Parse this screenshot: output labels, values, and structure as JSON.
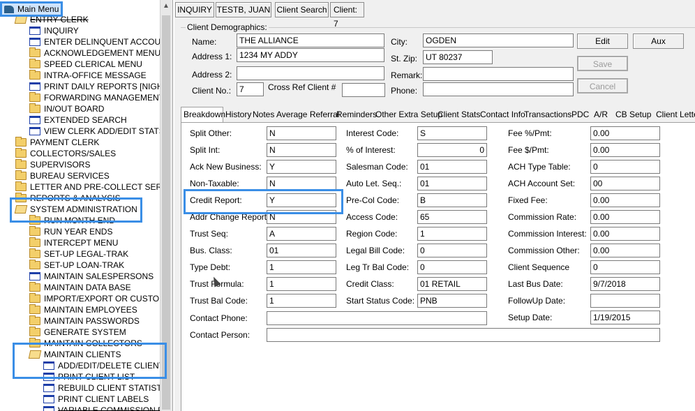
{
  "tree": {
    "main_menu": "Main Menu",
    "items": [
      {
        "label": "ENTRY CLERK",
        "icon": "open-folder-icon",
        "strike": true
      },
      {
        "label": "INQUIRY",
        "icon": "page-icon",
        "strike": false
      },
      {
        "label": "ENTER DELINQUENT ACCOUNT",
        "icon": "page-icon",
        "strike": false
      },
      {
        "label": "ACKNOWLEDGEMENT MENU",
        "icon": "folder-icon",
        "strike": false
      },
      {
        "label": "SPEED CLERICAL MENU",
        "icon": "folder-icon",
        "strike": false
      },
      {
        "label": "INTRA-OFFICE MESSAGE",
        "icon": "folder-icon",
        "strike": false
      },
      {
        "label": "PRINT DAILY REPORTS   [NIGHT",
        "icon": "page-icon",
        "strike": false
      },
      {
        "label": "FORWARDING MANAGEMENT",
        "icon": "folder-icon",
        "strike": false
      },
      {
        "label": "IN/OUT BOARD",
        "icon": "folder-icon",
        "strike": false
      },
      {
        "label": "EXTENDED SEARCH",
        "icon": "page-icon",
        "strike": false
      },
      {
        "label": "VIEW CLERK ADD/EDIT STATS",
        "icon": "page-icon",
        "strike": false
      },
      {
        "label": "PAYMENT CLERK",
        "icon": "folder-icon",
        "strike": false
      },
      {
        "label": "COLLECTORS/SALES",
        "icon": "folder-icon",
        "strike": false
      },
      {
        "label": "SUPERVISORS",
        "icon": "folder-icon",
        "strike": false
      },
      {
        "label": "BUREAU SERVICES",
        "icon": "folder-icon",
        "strike": false
      },
      {
        "label": "LETTER AND PRE-COLLECT SERVIC",
        "icon": "folder-icon",
        "strike": false
      },
      {
        "label": "REPORTS & ANALYSIS",
        "icon": "folder-icon",
        "strike": true
      },
      {
        "label": "SYSTEM ADMINISTRATION",
        "icon": "open-folder-icon",
        "strike": false
      },
      {
        "label": "RUN MONTH END",
        "icon": "folder-icon",
        "strike": true
      },
      {
        "label": "RUN YEAR ENDS",
        "icon": "folder-icon",
        "strike": false
      },
      {
        "label": "INTERCEPT MENU",
        "icon": "folder-icon",
        "strike": false
      },
      {
        "label": "SET-UP LEGAL-TRAK",
        "icon": "folder-icon",
        "strike": false
      },
      {
        "label": "SET-UP LOAN-TRAK",
        "icon": "folder-icon",
        "strike": false
      },
      {
        "label": "MAINTAIN SALESPERSONS",
        "icon": "page-icon",
        "strike": false
      },
      {
        "label": "MAINTAIN DATA BASE",
        "icon": "folder-icon",
        "strike": false
      },
      {
        "label": "IMPORT/EXPORT OR CUSTOM",
        "icon": "folder-icon",
        "strike": false
      },
      {
        "label": "MAINTAIN EMPLOYEES",
        "icon": "folder-icon",
        "strike": false
      },
      {
        "label": "MAINTAIN PASSWORDS",
        "icon": "folder-icon",
        "strike": false
      },
      {
        "label": "GENERATE SYSTEM",
        "icon": "folder-icon",
        "strike": false
      },
      {
        "label": "MAINTAIN COLLECTORS",
        "icon": "folder-icon",
        "strike": true
      },
      {
        "label": "MAINTAIN CLIENTS",
        "icon": "open-folder-icon",
        "strike": false
      },
      {
        "label": "ADD/EDIT/DELETE CLIENTS",
        "icon": "page-icon",
        "strike": false
      },
      {
        "label": "PRINT CLIENT LIST",
        "icon": "page-icon",
        "strike": true
      },
      {
        "label": "REBUILD CLIENT STATISTIC",
        "icon": "page-icon",
        "strike": false
      },
      {
        "label": "PRINT CLIENT LABELS",
        "icon": "page-icon",
        "strike": false
      },
      {
        "label": "VARIABLE COMMISSION RAT",
        "icon": "page-icon",
        "strike": true
      }
    ]
  },
  "toolbar": {
    "inquiry": "INQUIRY",
    "user": "TESTB, JUAN",
    "client_search": "Client Search",
    "client_no": "Client: 7"
  },
  "demographics": {
    "group_label": "Client Demographics:",
    "name_label": "Name:",
    "name": "THE ALLIANCE",
    "address1_label": "Address 1:",
    "address1": "1234 MY ADDY",
    "address2_label": "Address 2:",
    "address2": "",
    "clientno_label": "Client No.:",
    "clientno": "7",
    "crossref_label": "Cross Ref Client #",
    "crossref": "",
    "city_label": "City:",
    "city": "OGDEN",
    "stzip_label": "St. Zip:",
    "stzip": "UT 80237",
    "remark_label": "Remark:",
    "remark": "",
    "phone_label": "Phone:",
    "phone": "",
    "edit": "Edit",
    "aux": "Aux",
    "save": "Save",
    "cancel": "Cancel"
  },
  "tabs": [
    "Breakdown",
    "History",
    "Notes",
    "Average Referral",
    "Reminders",
    "Other Extra Setup",
    "Client Stats",
    "Contact Info",
    "Transactions",
    "PDC",
    "A/R",
    "CB Setup",
    "Client Letter"
  ],
  "breakdown": {
    "col1": [
      {
        "label": "Split Other:",
        "value": "N"
      },
      {
        "label": "Split Int:",
        "value": "N"
      },
      {
        "label": "Ack New Business:",
        "value": "Y"
      },
      {
        "label": "Non-Taxable:",
        "value": "N"
      },
      {
        "label": "Credit Report:",
        "value": "Y"
      },
      {
        "label": "Addr Change Report:",
        "value": "N"
      },
      {
        "label": "Trust Seq:",
        "value": "A"
      },
      {
        "label": "Bus. Class:",
        "value": "01"
      },
      {
        "label": "Type Debt:",
        "value": "1"
      },
      {
        "label": "Trust Formula:",
        "value": "1"
      },
      {
        "label": "Trust Bal Code:",
        "value": "1"
      }
    ],
    "col2": [
      {
        "label": "Interest Code:",
        "value": "S"
      },
      {
        "label": "% of Interest:",
        "value": "0"
      },
      {
        "label": "Salesman Code:",
        "value": "01"
      },
      {
        "label": "Auto Let. Seq.:",
        "value": "01"
      },
      {
        "label": "Pre-Col Code:",
        "value": "B"
      },
      {
        "label": "Access Code:",
        "value": "65"
      },
      {
        "label": "Region Code:",
        "value": "1"
      },
      {
        "label": "Legal Bill Code:",
        "value": "0"
      },
      {
        "label": "Leg Tr Bal Code:",
        "value": "0"
      },
      {
        "label": "Credit Class:",
        "value": "01 RETAIL"
      },
      {
        "label": "Start Status Code:",
        "value": "PNB"
      }
    ],
    "col3": [
      {
        "label": "Fee %/Pmt:",
        "value": "0.00"
      },
      {
        "label": "Fee $/Pmt:",
        "value": "0.00"
      },
      {
        "label": "ACH Type Table:",
        "value": "0"
      },
      {
        "label": "ACH Account Set:",
        "value": "00"
      },
      {
        "label": "Fixed Fee:",
        "value": "0.00"
      },
      {
        "label": "Commission Rate:",
        "value": "0.00"
      },
      {
        "label": "Commission Interest:",
        "value": "0.00"
      },
      {
        "label": "Commission Other:",
        "value": "0.00"
      },
      {
        "label": "Client Sequence",
        "value": "0"
      },
      {
        "label": "Last Bus Date:",
        "value": "9/7/2018"
      },
      {
        "label": "FollowUp Date:",
        "value": ""
      },
      {
        "label": "Setup Date:",
        "value": "1/19/2015"
      }
    ],
    "contact_phone_label": "Contact Phone:",
    "contact_phone": "",
    "contact_person_label": "Contact Person:",
    "contact_person": ""
  },
  "colors": {
    "highlight": "#3a8ee6",
    "folder": "#f3cf6a",
    "page": "#1e3fa8"
  }
}
